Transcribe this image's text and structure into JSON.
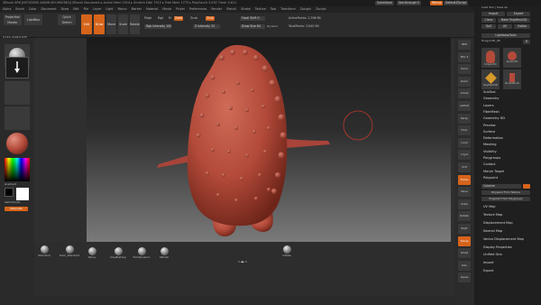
{
  "titlebar": {
    "text": "ZBrush 4R6 [NYCSDSSE-AKUMUGH-MKCBEQ]  ZBrush Document  ▸ Active Mem 1914 ▸ Scratch Disk 7912 ▸ Free Mem 1775 ▸ PolyCount 3.092 Timer 0.611",
    "quicksave": "QuickSave",
    "seethrough": "See-through 0",
    "menus": "Menus",
    "script": "DefaultZScript"
  },
  "menubar": [
    "Alpha",
    "Brush",
    "Color",
    "Document",
    "Draw",
    "Edit",
    "File",
    "Layer",
    "Light",
    "Macro",
    "Marker",
    "Material",
    "Movie",
    "Picker",
    "Preferences",
    "Render",
    "Stencil",
    "Stroke",
    "Texture",
    "Tool",
    "Transform",
    "Zplugin",
    "Zscript"
  ],
  "toolbar": {
    "projection_master": "Projection Master",
    "lightbox": "LightBox",
    "quick_sketch": "Quick Sketch",
    "edit": "Edit",
    "draw": "Draw",
    "move": "Move",
    "scale": "Scale",
    "rotate": "Rotate",
    "mrgb": "Mrgb",
    "rgb": "Rgb",
    "m": "M",
    "zadd": "Zadd",
    "zsub": "Zsub",
    "zcut": "Zcut",
    "rgb_intensity": "Rgb Intensity 100",
    "z_intensity": "Z Intensity 25",
    "focal_shift": "Focal Shift 0",
    "draw_size": "Draw Size 64",
    "dynamic": "Dynamic",
    "active_points": "ActivePoints: 2,396 Mil",
    "total_points": "TotalPoints: 3,640 Mil"
  },
  "left": {
    "coords": "0.115,-0.09,0.035",
    "gradient": "Gradient",
    "switchcolor": "SwitchColor",
    "alternate": "Alternate"
  },
  "bottom": {
    "buttons": [
      "Standard",
      "Dam_Standard",
      "Move",
      "ClayBuildup",
      "TrimDynamic",
      "hPolish",
      "inflate"
    ],
    "brush_label": "0 ◀▶ 0"
  },
  "righttray": [
    "BPR",
    "SPix 3",
    "Scroll",
    "Zoom",
    "Actual",
    "AAHalf",
    "Persp",
    "Floor",
    "Local",
    "L.Sym",
    "XYZ",
    "Frame",
    "Move",
    "Scale",
    "Rotate",
    "PolyF",
    "Transp",
    "Ghost",
    "Solo",
    "Xpose"
  ],
  "rightpanel": {
    "header": "Load Tool | Save As",
    "import": "Import",
    "export": "Export",
    "clone": "Clone",
    "make_polymesh": "Make PolyMesh3D",
    "goz": "GoZ",
    "all": "All",
    "visible": "Visible",
    "lightbox_tools": "Lightbox▸Tools",
    "tool_name": "Dragon3D_48",
    "r": "R",
    "thumbs": [
      "Dragon3D",
      "Sphere3D",
      "PolyMesh3D",
      "SimpleBrush"
    ],
    "sections": [
      "SubTool",
      "Geometry",
      "Layers",
      "FiberMesh",
      "Geometry HD",
      "Preview",
      "Surface",
      "Deformation",
      "Masking",
      "Visibility",
      "Polygroups",
      "Contact",
      "Morph Target",
      "Polypaint"
    ],
    "colorize": "Colorize",
    "polypaint_from_texture": "Polypaint From Texture",
    "polypaint_from_polygroups": "Polypaint From Polygroups",
    "sections2": [
      "UV Map",
      "Texture Map",
      "Displacement Map",
      "Normal Map",
      "Vector Displacement Map",
      "Display Properties",
      "Unified Skin",
      "Import",
      "Export"
    ]
  },
  "colors": {
    "accent": "#d6641b",
    "clay": "#b34a3a",
    "bg": "#2a2a2a"
  }
}
